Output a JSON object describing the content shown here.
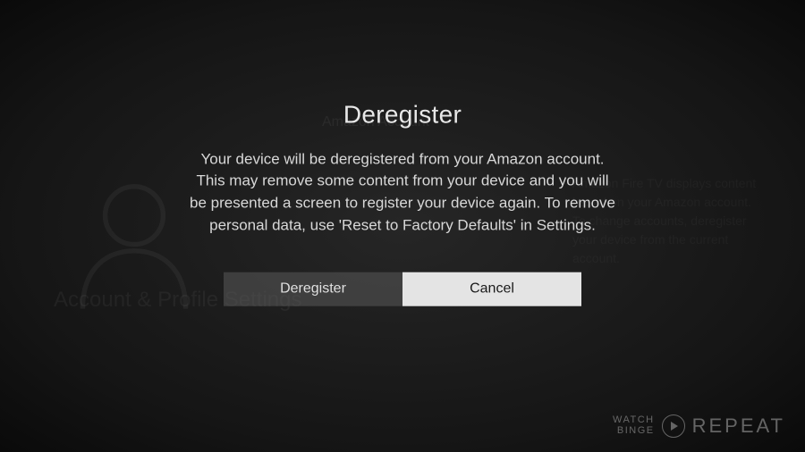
{
  "dialog": {
    "title": "Deregister",
    "body": "Your device will be deregistered from your Amazon account. This may remove some content from your device and you will be presented a screen to register your device again. To remove personal data, use 'Reset to Factory Defaults' in Settings.",
    "primary_action": "Cancel",
    "secondary_action": "Deregister"
  },
  "background": {
    "breadcrumb": "Amazon Account",
    "setting_label": "Account & Profile Settings",
    "sidetext": "Amazon Fire TV displays content based on your Amazon account. To change accounts, deregister your device from the current account."
  },
  "watermark": {
    "line1": "WATCH",
    "line2": "BINGE",
    "repeat": "REPEAT"
  }
}
